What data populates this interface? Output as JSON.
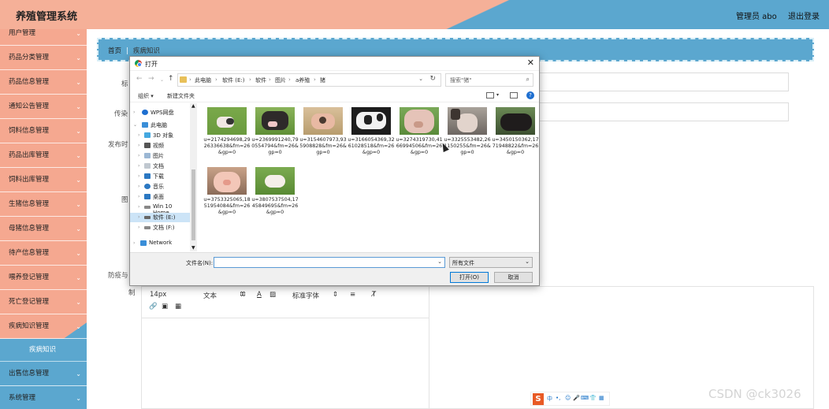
{
  "header": {
    "title": "养殖管理系统",
    "user": "管理员 abo",
    "logout": "退出登录"
  },
  "sidebar": {
    "items": [
      {
        "label": "用户管理"
      },
      {
        "label": "药品分类管理"
      },
      {
        "label": "药品信息管理"
      },
      {
        "label": "通知公告管理"
      },
      {
        "label": "饲料信息管理"
      },
      {
        "label": "药品出库管理"
      },
      {
        "label": "饲料出库管理"
      },
      {
        "label": "生猪信息管理"
      },
      {
        "label": "母猪信息管理"
      },
      {
        "label": "待产信息管理"
      },
      {
        "label": "喂养登记管理"
      },
      {
        "label": "死亡登记管理"
      },
      {
        "label": "疾病知识管理"
      },
      {
        "label": "出售信息管理"
      },
      {
        "label": "系统管理"
      }
    ],
    "sub_item": "疾病知识"
  },
  "breadcrumb": {
    "home": "首页",
    "separator": "|",
    "current": "疾病知识"
  },
  "form": {
    "labels": [
      "标",
      "传染",
      "发布时",
      "图",
      "防疫与",
      "制"
    ],
    "editor": {
      "size": "14px",
      "text_type": "文本",
      "font": "标准字体"
    }
  },
  "dialog": {
    "title": "打开",
    "path": [
      "此电脑",
      "软件 (E:)",
      "软件",
      "图片",
      "a养殖",
      "猪"
    ],
    "search_placeholder": "搜索\"猪\"",
    "organize": "组织 ▾",
    "new_folder": "新建文件夹",
    "tree": [
      {
        "label": "WPS网盘"
      },
      {
        "label": "此电脑"
      },
      {
        "label": "3D 对象"
      },
      {
        "label": "视频"
      },
      {
        "label": "图片"
      },
      {
        "label": "文档"
      },
      {
        "label": "下载"
      },
      {
        "label": "音乐"
      },
      {
        "label": "桌面"
      },
      {
        "label": "Win 10 Home"
      },
      {
        "label": "软件 (E:)"
      },
      {
        "label": "文档 (F:)"
      },
      {
        "label": "Network"
      }
    ],
    "files": [
      {
        "name": "u=2174294698,2926336638&fm=26&gp=0"
      },
      {
        "name": "u=2369991240,790554794&fm=26&gp=0"
      },
      {
        "name": "u=3154607973,935908828&fm=26&gp=0"
      },
      {
        "name": "u=3166054369,3261028518&fm=26&gp=0"
      },
      {
        "name": "u=3274319730,4166994506&fm=26&gp=0"
      },
      {
        "name": "u=3325553482,261150255&fm=26&gp=0"
      },
      {
        "name": "u=3450150362,1771948822&fm=26&gp=0"
      },
      {
        "name": "u=3753325065,1851954084&fm=26&gp=0"
      },
      {
        "name": "u=3807537504,1745849695&fm=26&gp=0"
      }
    ],
    "filename_label": "文件名(N):",
    "filename_value": "",
    "filetype": "所有文件",
    "open_btn": "打开(O)",
    "cancel_btn": "取消"
  },
  "ime": {
    "lang": "中"
  },
  "watermark": "CSDN @ck3026"
}
